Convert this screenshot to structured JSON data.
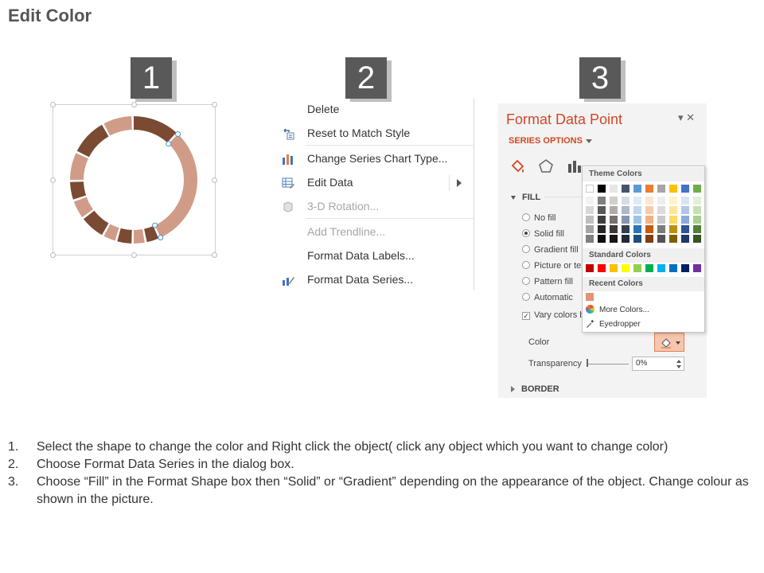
{
  "page": {
    "title": "Edit Color"
  },
  "steps": [
    "1",
    "2",
    "3"
  ],
  "donut": {
    "colors": {
      "dark": "#7a4a33",
      "light": "#d09c88"
    }
  },
  "context_menu": {
    "items": [
      {
        "label": "Delete",
        "icon": "none-icon",
        "disabled": false
      },
      {
        "label": "Reset to Match Style",
        "icon": "reset-style-icon",
        "disabled": false
      },
      {
        "label": "Change Series Chart Type...",
        "icon": "bar-chart-icon",
        "disabled": false
      },
      {
        "label": "Edit Data",
        "icon": "edit-data-icon",
        "disabled": false,
        "submenu": true
      },
      {
        "label": "3-D Rotation...",
        "icon": "cube-icon",
        "disabled": true
      },
      {
        "label": "Add Trendline...",
        "icon": "none-icon",
        "disabled": true
      },
      {
        "label": "Format Data Labels...",
        "icon": "none-icon",
        "disabled": false
      },
      {
        "label": "Format Data Series...",
        "icon": "format-series-icon",
        "disabled": false
      }
    ]
  },
  "format_pane": {
    "title": "Format Data Point",
    "controls": "▾ ✕",
    "series_options": "SERIES OPTIONS",
    "tabs": [
      "paint-bucket-icon",
      "pentagon-icon",
      "bar-chart-icon"
    ],
    "fill_section": "FILL",
    "fill_options": [
      {
        "label": "No fill",
        "selected": false
      },
      {
        "label": "Solid fill",
        "selected": true
      },
      {
        "label": "Gradient fill",
        "selected": false
      },
      {
        "label": "Picture or tex",
        "selected": false
      },
      {
        "label": "Pattern fill",
        "selected": false
      },
      {
        "label": "Automatic",
        "selected": false
      }
    ],
    "vary_colors": {
      "label": "Vary colors b",
      "checked": true
    },
    "color_label": "Color",
    "transparency_label": "Transparency",
    "transparency_value": "0%",
    "border_section": "BORDER",
    "accent_color": "#d24726"
  },
  "color_picker": {
    "theme_header": "Theme Colors",
    "theme_top": [
      "#ffffff",
      "#000000",
      "#e7e6e6",
      "#44546a",
      "#5b9bd5",
      "#ed7d31",
      "#a5a5a5",
      "#ffc000",
      "#4472c4",
      "#70ad47"
    ],
    "theme_shades": [
      [
        "#f2f2f2",
        "#7f7f7f",
        "#d0cece",
        "#d6dce4",
        "#deebf6",
        "#fbe5d5",
        "#ededed",
        "#fff2cc",
        "#dae3f3",
        "#e2efd9"
      ],
      [
        "#d8d8d8",
        "#595959",
        "#aeabab",
        "#adb9ca",
        "#bdd7ee",
        "#f7cbac",
        "#dbdbdb",
        "#fee599",
        "#b4c6e7",
        "#c5e0b3"
      ],
      [
        "#bfbfbf",
        "#3f3f3f",
        "#757070",
        "#8496b0",
        "#9cc3e5",
        "#f4b183",
        "#c9c9c9",
        "#ffd965",
        "#8eaadb",
        "#a8d08d"
      ],
      [
        "#a5a5a5",
        "#262626",
        "#3a3838",
        "#323f4f",
        "#2e75b5",
        "#c55a11",
        "#7b7b7b",
        "#bf9000",
        "#2f5496",
        "#538135"
      ],
      [
        "#7f7f7f",
        "#0c0c0c",
        "#171616",
        "#222a35",
        "#1e4e79",
        "#833c0b",
        "#525252",
        "#7f6000",
        "#1f3864",
        "#375623"
      ]
    ],
    "standard_header": "Standard Colors",
    "standard": [
      "#c00000",
      "#ff0000",
      "#ffc000",
      "#ffff00",
      "#92d050",
      "#00b050",
      "#00b0f0",
      "#0070c0",
      "#002060",
      "#7030a0"
    ],
    "recent_header": "Recent Colors",
    "recent": [
      "#e39472"
    ],
    "more_colors": "More Colors...",
    "eyedropper": "Eyedropper"
  },
  "instructions": [
    {
      "num": "1.",
      "text": "Select the shape to change the color and Right click the object( click any object which you want to change color)"
    },
    {
      "num": "2.",
      "text": "Choose Format Data Series in the dialog box."
    },
    {
      "num": "3.",
      "text": "Choose “Fill” in the Format Shape box then “Solid” or “Gradient” depending on the appearance of the object. Change colour as shown in the picture."
    }
  ]
}
